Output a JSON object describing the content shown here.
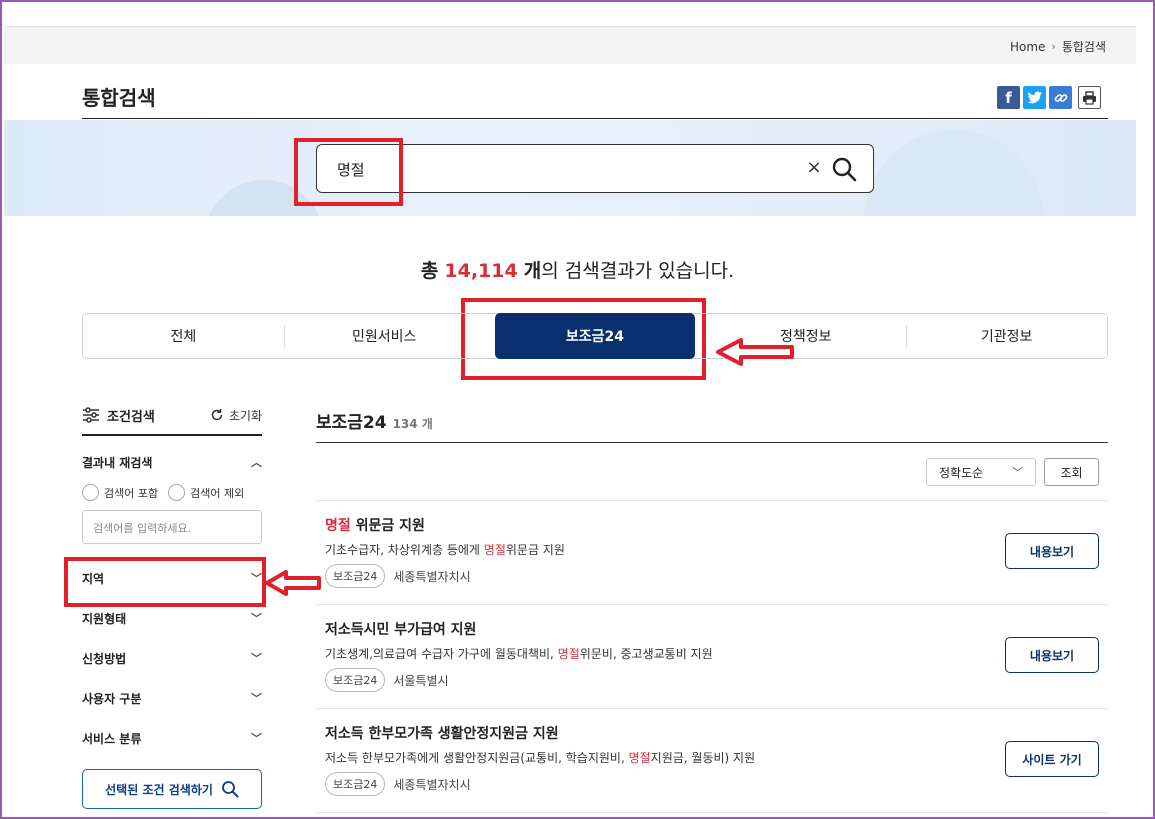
{
  "breadcrumb": {
    "home": "Home",
    "current": "통합검색"
  },
  "page_title": "통합검색",
  "share": {
    "facebook": "f",
    "twitter": "t",
    "link": "🔗",
    "print": "⎙"
  },
  "search": {
    "value": "명절",
    "clear": "×"
  },
  "result_count": {
    "prefix": "총",
    "number": "14,114",
    "unit": "개",
    "suffix": "의 검색결과가 있습니다."
  },
  "tabs": [
    "전체",
    "민원서비스",
    "보조금24",
    "정책정보",
    "기관정보"
  ],
  "sidebar": {
    "header": "조건검색",
    "reset": "초기화",
    "refine": "결과내 재검색",
    "include": "검색어 포함",
    "exclude": "검색어 제외",
    "input_placeholder": "검색어를 입력하세요.",
    "filters": [
      "지역",
      "지원형태",
      "신청방법",
      "사용자 구분",
      "서비스 분류"
    ],
    "search_button": "선택된 조건 검색하기"
  },
  "main": {
    "title": "보조금24",
    "count": "134 개",
    "sort": "정확도순",
    "go": "조회"
  },
  "results": [
    {
      "title_hl": "명절",
      "title_rest": " 위문금 지원",
      "desc_pre": "기초수급자, 차상위계층 등에게 ",
      "desc_hl": "명절",
      "desc_post": "위문금 지원",
      "tag": "보조금24",
      "org": "세종특별자치시",
      "button": "내용보기"
    },
    {
      "title_hl": "",
      "title_rest": "저소득시민 부가급여 지원",
      "desc_pre": "기초생계,의료급여 수급자 가구에 월동대책비, ",
      "desc_hl": "명절",
      "desc_post": "위문비, 중고생교통비 지원",
      "tag": "보조금24",
      "org": "서울특별시",
      "button": "내용보기"
    },
    {
      "title_hl": "",
      "title_rest": "저소득 한부모가족 생활안정지원금 지원",
      "desc_pre": "저소득 한부모가족에게 생활안정지원금(교통비, 학습지원비, ",
      "desc_hl": "명절",
      "desc_post": "지원금, 월동비) 지원",
      "tag": "보조금24",
      "org": "세종특별자치시",
      "button": "사이트 가기"
    }
  ],
  "colors": {
    "accent": "#0a2f6e",
    "highlight": "#d92c3a",
    "annotation": "#e2202b"
  }
}
